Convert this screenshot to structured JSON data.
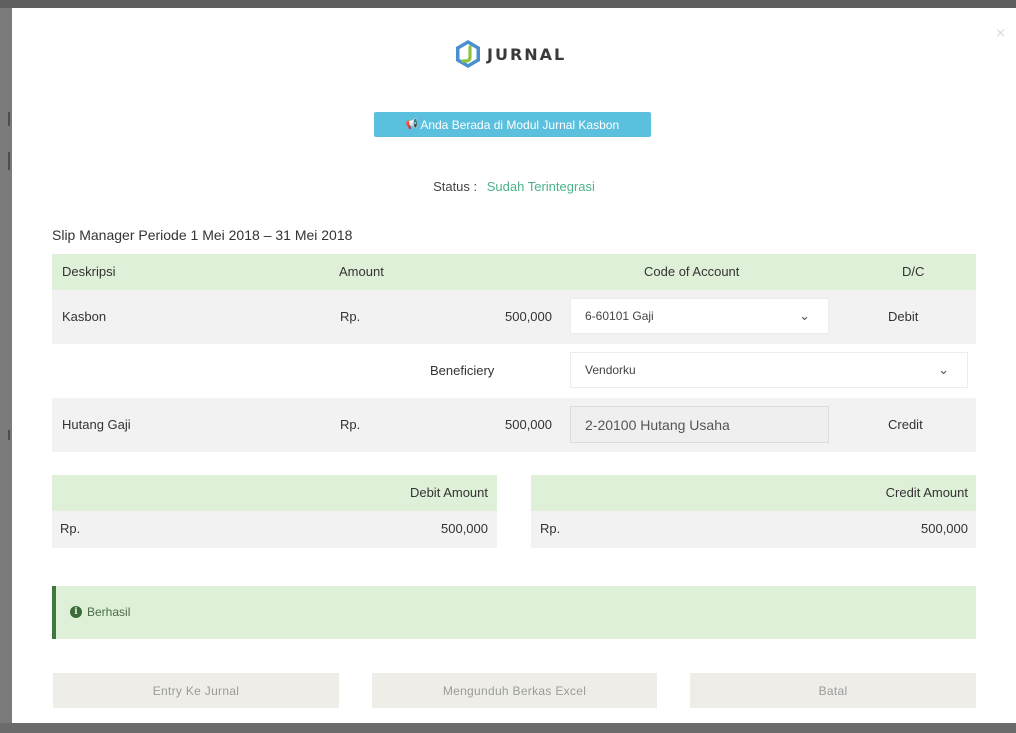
{
  "logo": {
    "text": "JURNAL",
    "icon": "jurnal-logo-icon",
    "colors": {
      "blue": "#4a8fd1",
      "green": "#8cc63f"
    }
  },
  "module_banner": {
    "icon": "megaphone-icon",
    "text": "Anda Berada di Modul Jurnal Kasbon"
  },
  "status": {
    "label": "Status :",
    "value": "Sudah Terintegrasi",
    "value_color": "#4bb38a"
  },
  "slip_title": "Slip Manager Periode 1 Mei 2018 – 31 Mei 2018",
  "table": {
    "headers": {
      "description": "Deskripsi",
      "amount": "Amount",
      "code_of_account": "Code of Account",
      "dc": "D/C"
    },
    "debit_row": {
      "description": "Kasbon",
      "currency": "Rp.",
      "amount": "500,000",
      "account": "6-60101 Gaji",
      "dc": "Debit"
    },
    "beneficiary_row": {
      "label": "Beneficiery",
      "value": "Vendorku"
    },
    "credit_row": {
      "description": "Hutang Gaji",
      "currency": "Rp.",
      "amount": "500,000",
      "account": "2-20100 Hutang Usaha",
      "dc": "Credit"
    }
  },
  "summary": {
    "debit": {
      "header": "Debit Amount",
      "currency": "Rp.",
      "value": "500,000"
    },
    "credit": {
      "header": "Credit Amount",
      "currency": "Rp.",
      "value": "500,000"
    }
  },
  "alert": {
    "icon": "info-circle-icon",
    "text": "Berhasil"
  },
  "buttons": {
    "entry": "Entry Ke Jurnal",
    "download": "Mengunduh Berkas Excel",
    "cancel": "Batal"
  },
  "colors": {
    "header_green": "#dff0d8",
    "banner_blue": "#5bc0de",
    "alert_border": "#3c7a3a",
    "row_grey": "#f2f2f2"
  }
}
